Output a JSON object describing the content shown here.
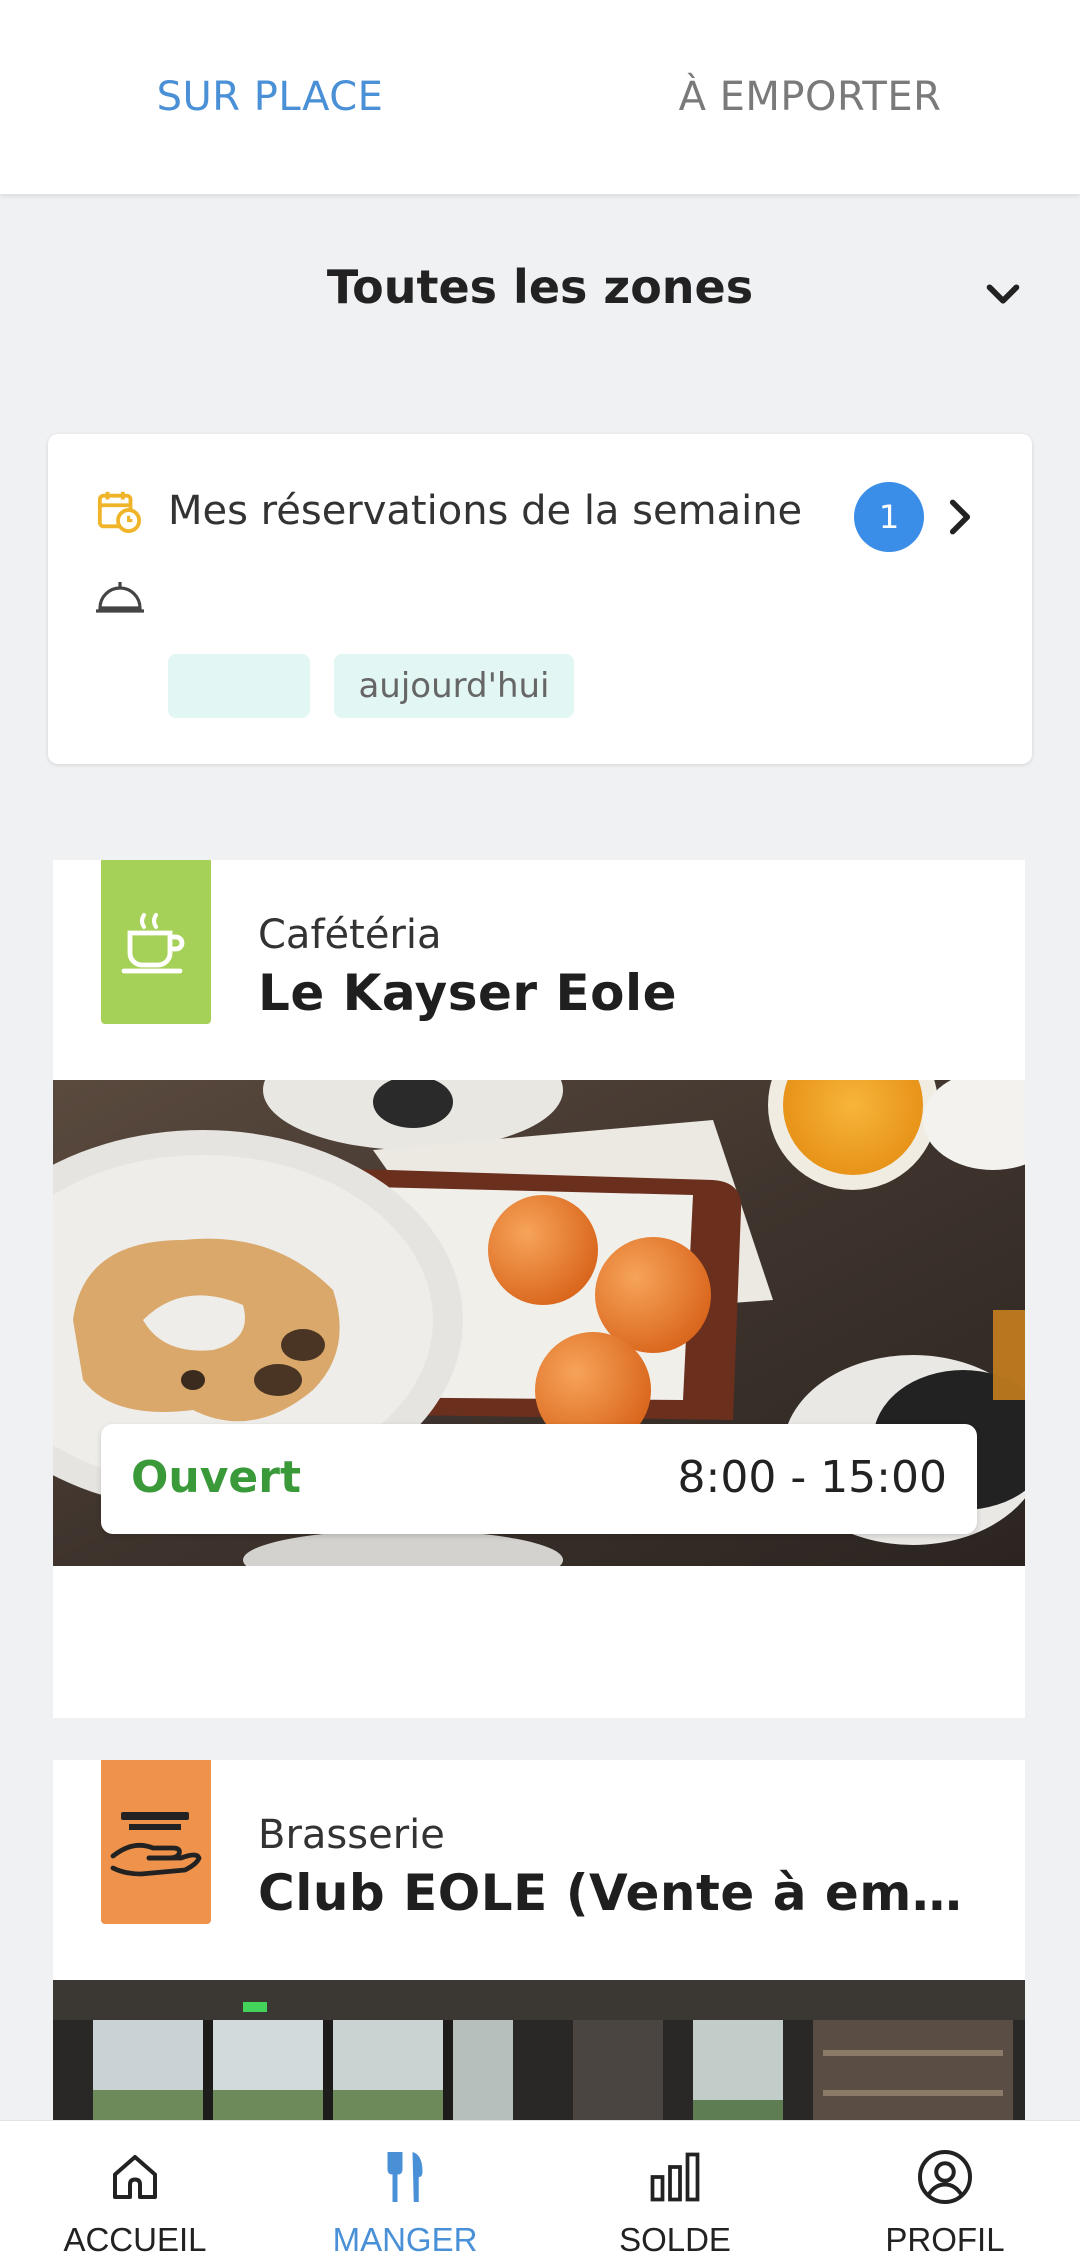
{
  "tabs": {
    "dine_in": "SUR PLACE",
    "takeaway": "À EMPORTER"
  },
  "zone": {
    "title": "Toutes les zones"
  },
  "reservations": {
    "title": "Mes réservations de la semaine",
    "count": "1",
    "chip_empty": "",
    "chip_today": "aujourd'hui"
  },
  "restaurants": [
    {
      "type": "Cafétéria",
      "name": "Le Kayser Eole",
      "icon": "coffee-cup-icon",
      "icon_color": "#a6d158",
      "status": "Ouvert",
      "hours": "8:00 - 15:00"
    },
    {
      "type": "Brasserie",
      "name": "Club EOLE  (Vente à emporter)",
      "icon": "serving-hand-icon",
      "icon_color": "#ef934c"
    }
  ],
  "nav": {
    "home": "ACCUEIL",
    "eat": "MANGER",
    "balance": "SOLDE",
    "profile": "PROFIL"
  },
  "colors": {
    "accent": "#4a90d6",
    "badge": "#3b8ee8",
    "open": "#3a9a3a",
    "chip_bg": "#e2f6f3"
  }
}
